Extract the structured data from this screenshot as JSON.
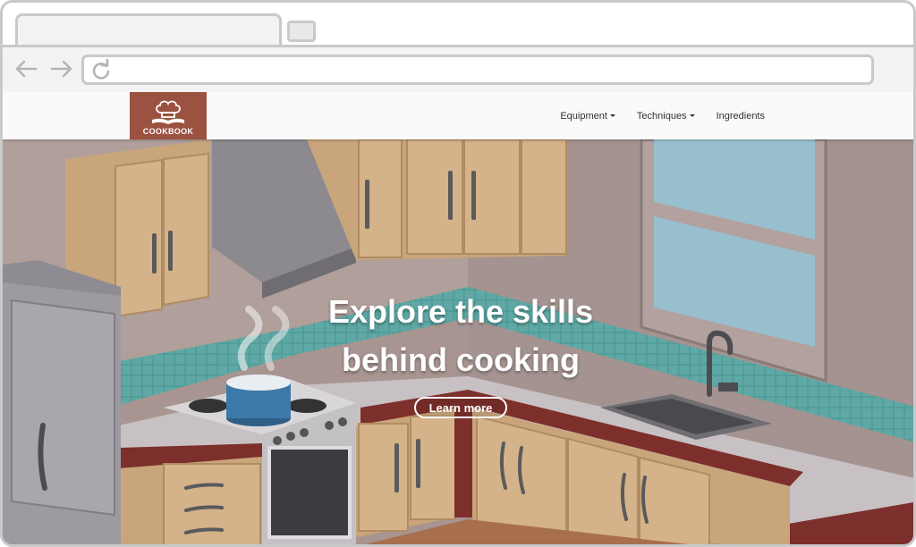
{
  "browser": {
    "url": "",
    "back_icon": "arrow-left-icon",
    "forward_icon": "arrow-right-icon",
    "reload_icon": "reload-icon"
  },
  "site": {
    "logo_text": "COOKBOOK",
    "logo_icon": "chef-hat-book-icon",
    "brand_color": "#9c5241",
    "nav": [
      {
        "label": "Equipment",
        "dropdown": true
      },
      {
        "label": "Techniques",
        "dropdown": true
      },
      {
        "label": "Ingredients",
        "dropdown": false
      }
    ]
  },
  "hero": {
    "title_line1": "Explore the skills",
    "title_line2": "behind cooking",
    "cta_label": "Learn more"
  }
}
